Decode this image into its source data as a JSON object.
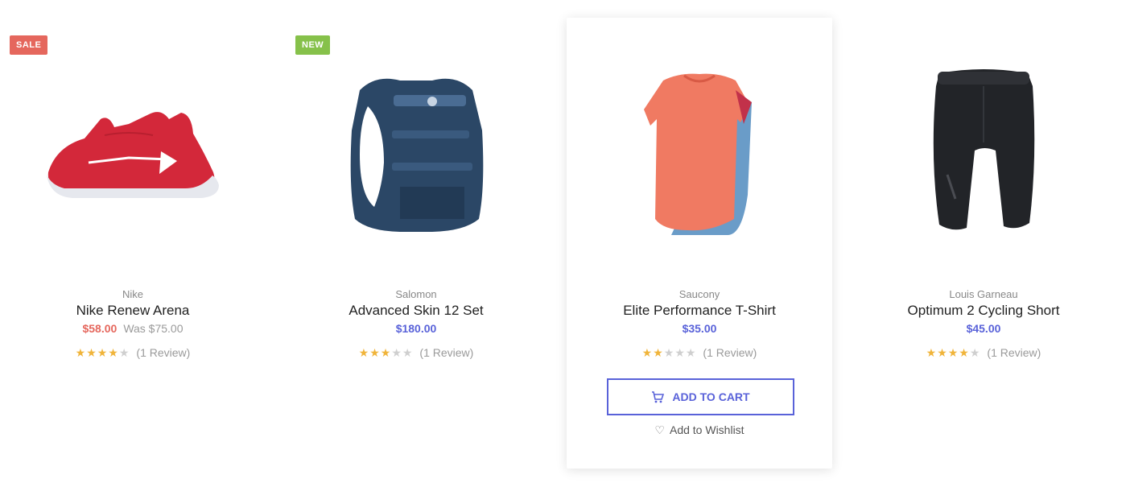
{
  "products": [
    {
      "badge": "SALE",
      "badge_type": "sale",
      "brand": "Nike",
      "name": "Nike Renew Arena",
      "price": "$58.00",
      "was": "Was $75.00",
      "rating": 4,
      "reviews": "(1 Review)",
      "image": "red-sneaker",
      "colors": {
        "main": "#d3283a",
        "sole": "#e6e8ee"
      }
    },
    {
      "badge": "NEW",
      "badge_type": "new",
      "brand": "Salomon",
      "name": "Advanced Skin 12 Set",
      "price": "$180.00",
      "rating": 3,
      "reviews": "(1 Review)",
      "image": "blue-hydration-vest",
      "colors": {
        "main": "#2b4766",
        "accent": "#4a6c93"
      }
    },
    {
      "brand": "Saucony",
      "name": "Elite Performance T-Shirt",
      "price": "$35.00",
      "rating": 2,
      "reviews": "(1 Review)",
      "image": "coral-tshirt",
      "colors": {
        "main": "#f07a62",
        "accent": "#6a9cc8"
      },
      "button": "ADD TO CART",
      "wishlist": "Add to Wishlist"
    },
    {
      "brand": "Louis Garneau",
      "name": "Optimum 2 Cycling Short",
      "price": "$45.00",
      "rating": 4,
      "reviews": "(1 Review)",
      "image": "black-cycling-short",
      "colors": {
        "main": "#222428",
        "accent": "#4a4c52"
      }
    }
  ],
  "accent_color": "#5962d9",
  "star_color": "#f0b43a"
}
